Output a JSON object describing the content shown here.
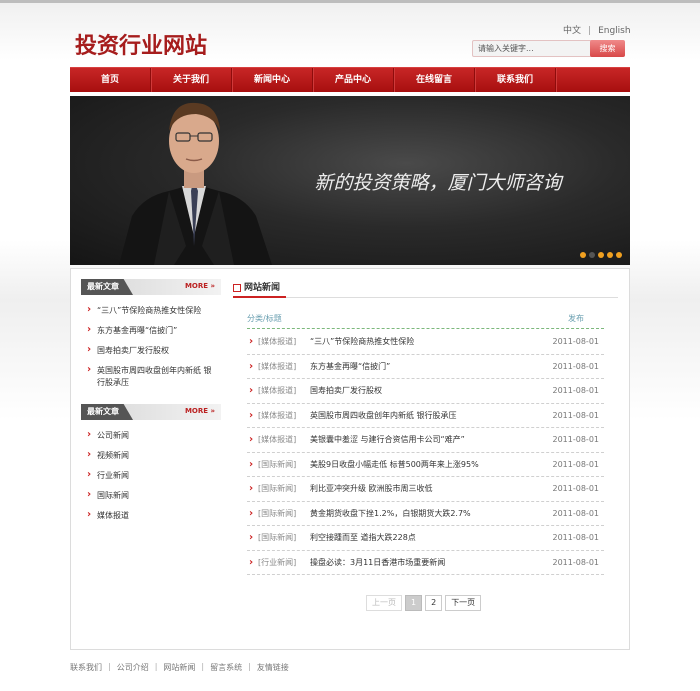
{
  "site": {
    "logo": "投资行业网站"
  },
  "lang": {
    "cn": "中文",
    "sep": "|",
    "en": "English"
  },
  "search": {
    "placeholder": "请输入关键字...",
    "button": "搜索"
  },
  "nav": [
    "首页",
    "关于我们",
    "新闻中心",
    "产品中心",
    "在线留言",
    "联系我们"
  ],
  "banner": {
    "text": "新的投资策略，厦门大师咨询",
    "slides": 5,
    "active_slide": 1
  },
  "sidebar": {
    "latest": {
      "title": "最新文章",
      "more": "MORE »",
      "items": [
        "“三八”节保险商热推女性保险",
        "东方基金再曝“信披门”",
        "国寿拍卖厂发行股权",
        "英国股市周四收盘创年内新纸 银行股承压"
      ]
    },
    "categories": {
      "title": "最新文章",
      "more": "MORE »",
      "items": [
        "公司新闻",
        "视频新闻",
        "行业新闻",
        "国际新闻",
        "媒体报道"
      ]
    }
  },
  "news": {
    "title": "网站新闻",
    "col_title": "分类/标题",
    "col_date": "发布",
    "rows": [
      {
        "cat": "[媒体报道]",
        "title": "“三八”节保险商热推女性保险",
        "date": "2011-08-01"
      },
      {
        "cat": "[媒体报道]",
        "title": "东方基金再曝“信披门”",
        "date": "2011-08-01"
      },
      {
        "cat": "[媒体报道]",
        "title": "国寿拍卖厂发行股权",
        "date": "2011-08-01"
      },
      {
        "cat": "[媒体报道]",
        "title": "英国股市周四收盘创年内新纸 银行股承压",
        "date": "2011-08-01"
      },
      {
        "cat": "[媒体报道]",
        "title": "美银囊中羞涩 与建行合资信用卡公司“难产”",
        "date": "2011-08-01"
      },
      {
        "cat": "[国际新闻]",
        "title": "美股9日收盘小幅走低 标普500两年来上涨95%",
        "date": "2011-08-01"
      },
      {
        "cat": "[国际新闻]",
        "title": "利比亚冲突升级 欧洲股市周三收低",
        "date": "2011-08-01"
      },
      {
        "cat": "[国际新闻]",
        "title": "黄金期货收盘下挫1.2%，白银期货大跌2.7%",
        "date": "2011-08-01"
      },
      {
        "cat": "[国际新闻]",
        "title": "利空接踵而至 道指大跌228点",
        "date": "2011-08-01"
      },
      {
        "cat": "[行业新闻]",
        "title": "操盘必读：3月11日香港市场重要新闻",
        "date": "2011-08-01"
      }
    ]
  },
  "pager": {
    "prev": "上一页",
    "pages": [
      "1",
      "2"
    ],
    "next": "下一页"
  },
  "footer": [
    "联系我们",
    "公司介绍",
    "网站新闻",
    "留言系统",
    "友情链接"
  ],
  "colors": {
    "brand": "#a61d1d",
    "nav": "#b81a1a",
    "accent_dot": "#f0a020"
  }
}
